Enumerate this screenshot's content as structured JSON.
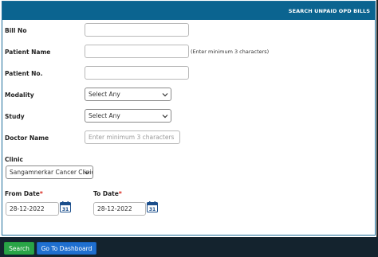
{
  "header": {
    "title": "SEARCH UNPAID OPD BILLS"
  },
  "form": {
    "bill_no": {
      "label": "Bill No",
      "value": ""
    },
    "patient_name": {
      "label": "Patient Name",
      "value": "",
      "hint": "(Enter minimum 3 characters)"
    },
    "patient_no": {
      "label": "Patient No.",
      "value": ""
    },
    "modality": {
      "label": "Modality",
      "selected": "Select Any"
    },
    "study": {
      "label": "Study",
      "selected": "Select Any"
    },
    "doctor_name": {
      "label": "Doctor Name",
      "placeholder": "Enter minimum 3 characters"
    },
    "clinic": {
      "label": "Clinic",
      "selected": "Sangamnerkar Cancer Clinic"
    },
    "from_date": {
      "label": "From Date",
      "required_mark": "*",
      "value": "28-12-2022",
      "calendar_day": "31"
    },
    "to_date": {
      "label": "To Date",
      "required_mark": "*",
      "value": "28-12-2022",
      "calendar_day": "31"
    }
  },
  "footer": {
    "search_label": "Search",
    "dashboard_label": "Go To Dashboard"
  },
  "colors": {
    "header": "#0b6490",
    "footer": "#14232e",
    "search_button": "#29a447",
    "dashboard_button": "#1f6fd0",
    "required": "#d9261c"
  }
}
